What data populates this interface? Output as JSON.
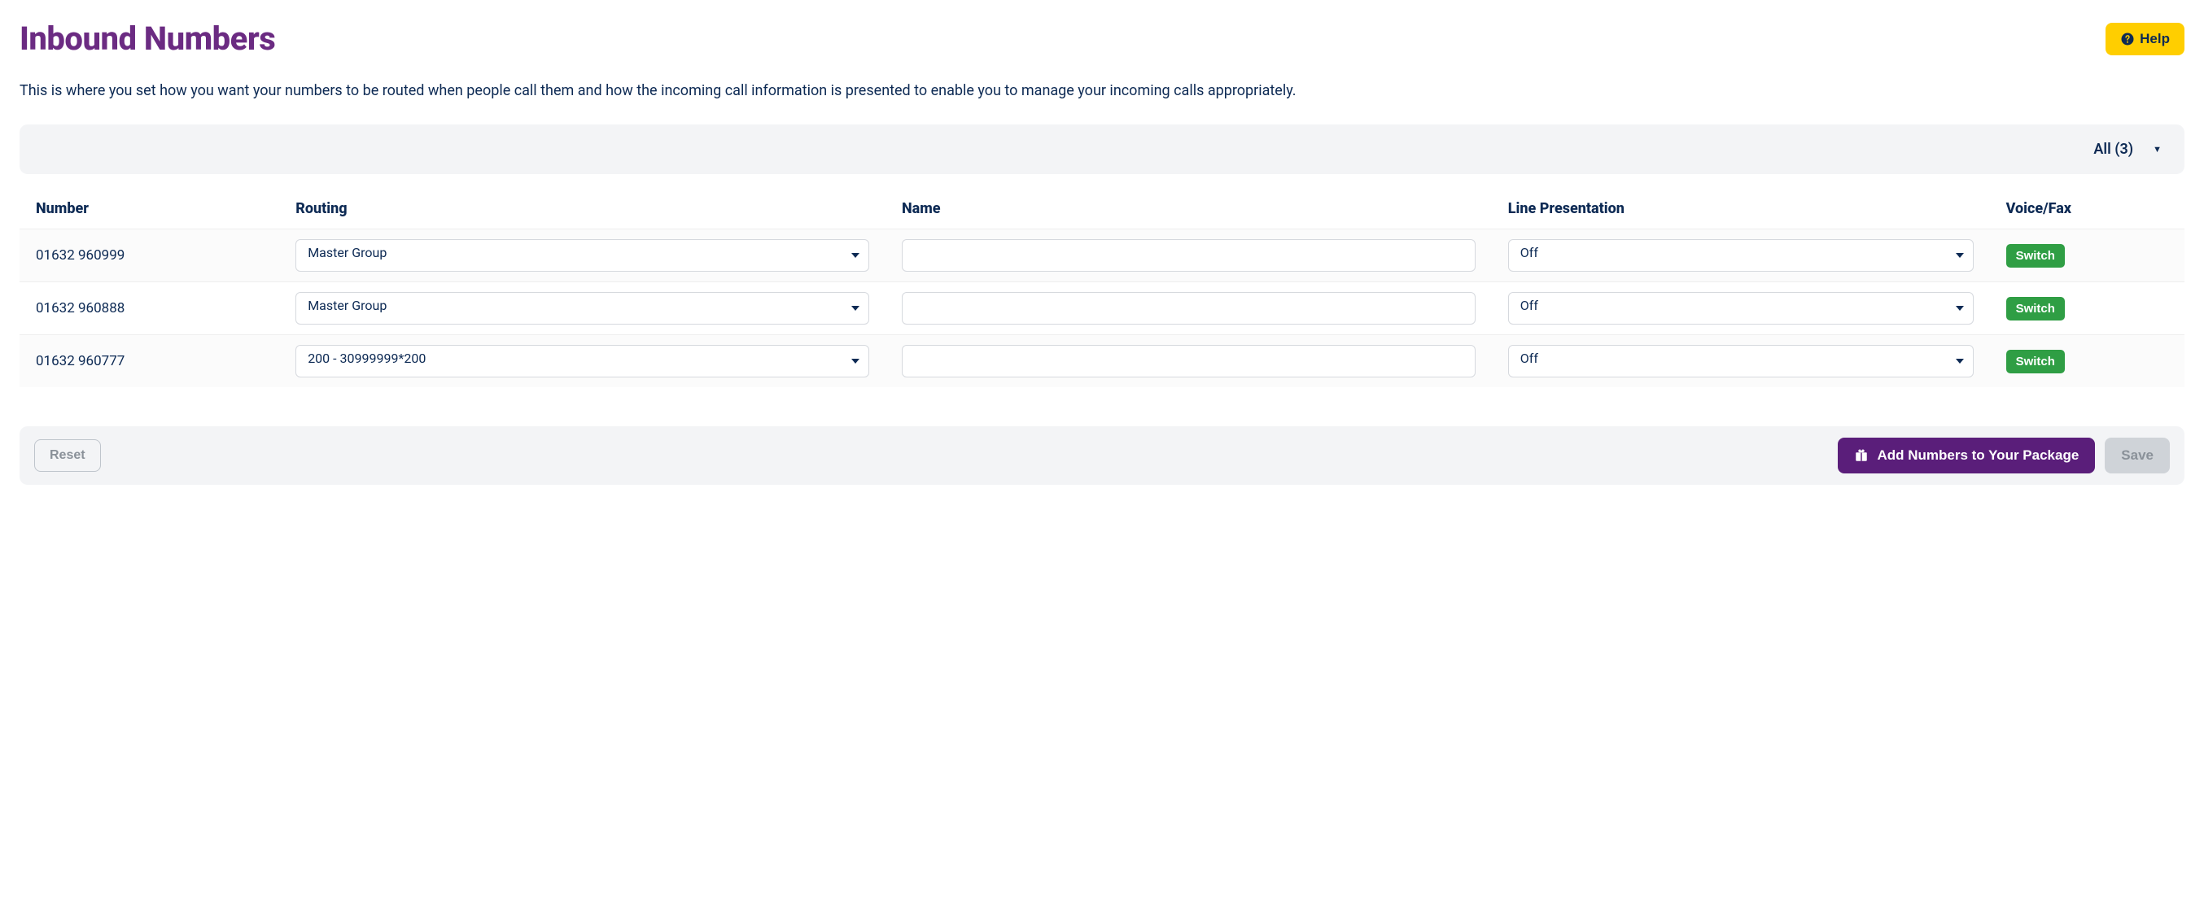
{
  "header": {
    "title": "Inbound Numbers",
    "help_label": "Help"
  },
  "description": "This is where you set how you want your numbers to be routed when people call them and how the incoming call information is presented to enable you to manage your incoming calls appropriately.",
  "filter": {
    "label": "All (3)"
  },
  "table": {
    "headers": {
      "number": "Number",
      "routing": "Routing",
      "name": "Name",
      "line_presentation": "Line Presentation",
      "voice_fax": "Voice/Fax"
    },
    "switch_label": "Switch",
    "rows": [
      {
        "number": "01632 960999",
        "routing": "Master Group",
        "name": "",
        "line_presentation": "Off"
      },
      {
        "number": "01632 960888",
        "routing": "Master Group",
        "name": "",
        "line_presentation": "Off"
      },
      {
        "number": "01632 960777",
        "routing": "200 - 30999999*200",
        "name": "",
        "line_presentation": "Off"
      }
    ]
  },
  "footer": {
    "reset_label": "Reset",
    "add_label": "Add Numbers to Your Package",
    "save_label": "Save"
  }
}
